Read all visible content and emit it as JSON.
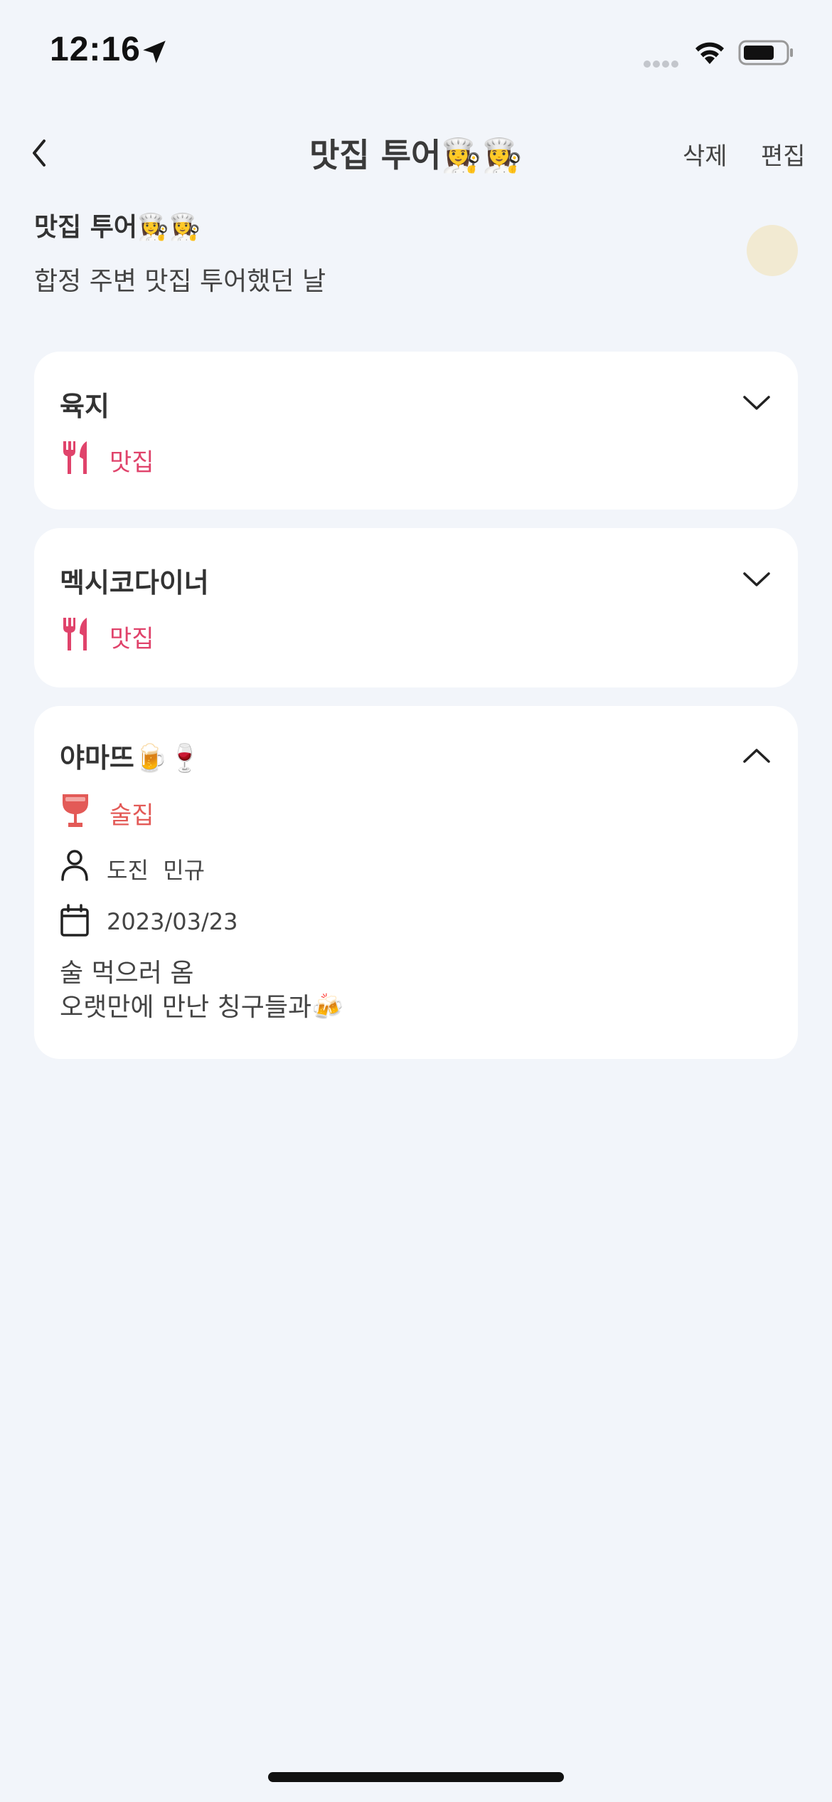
{
  "status": {
    "time": "12:16"
  },
  "nav": {
    "title": "맛집 투어👩‍🍳👩‍🍳",
    "delete_label": "삭제",
    "edit_label": "편집"
  },
  "course": {
    "title": "맛집 투어👩‍🍳👩‍🍳",
    "description": "합정 주변 맛집 투어했던 날",
    "avatar_color": "#f2ead2"
  },
  "colors": {
    "restaurant": "#e0436b",
    "bar": "#e35a57",
    "background": "#f2f5fa"
  },
  "places": [
    {
      "name": "육지",
      "category": "맛집",
      "category_icon": "fork-knife-icon",
      "expanded": false
    },
    {
      "name": "멕시코다이너",
      "category": "맛집",
      "category_icon": "fork-knife-icon",
      "expanded": false
    },
    {
      "name": "야마뜨🍺🍷",
      "category": "술집",
      "category_icon": "wine-glass-icon",
      "expanded": true,
      "friends": "도진  민규",
      "date": "2023/03/23",
      "memo_line1": "술 먹으러 옴",
      "memo_line2": "오랫만에 만난 칭구들과🍻"
    }
  ]
}
